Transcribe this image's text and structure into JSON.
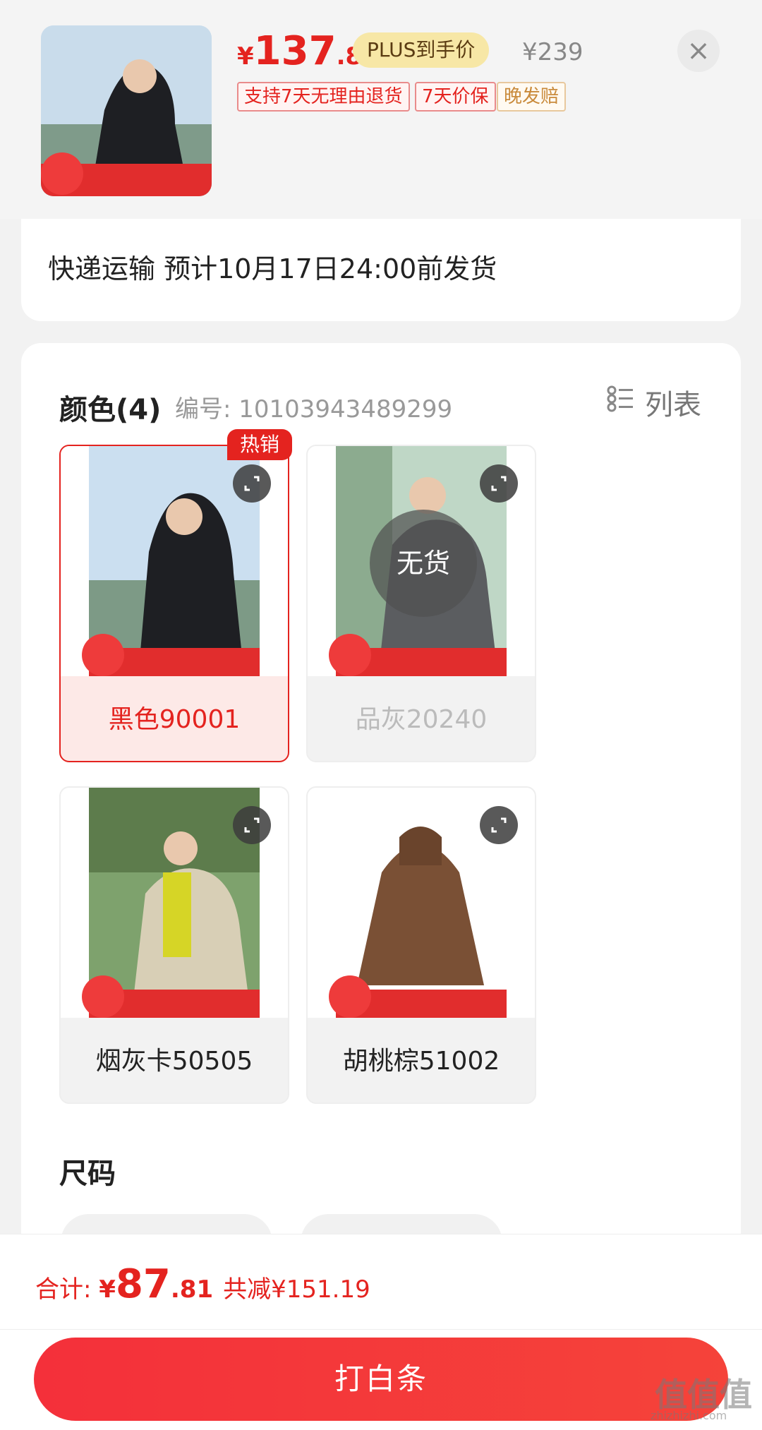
{
  "header": {
    "price_currency": "¥",
    "price_integer": "137",
    "price_decimal": ".81",
    "plus_badge": "PLUS到手价",
    "original_price": "¥239",
    "tags": [
      "支持7天无理由退货",
      "7天价保",
      "晚发赔"
    ]
  },
  "shipping": {
    "text": "快递运输 预计10月17日24:00前发货"
  },
  "color_section": {
    "title": "颜色(4)",
    "sku": "编号: 10103943489299",
    "list_label": "列表",
    "hot_badge": "热销",
    "no_stock_label": "无货",
    "variants": [
      {
        "name": "黑色90001"
      },
      {
        "name": "品灰20240"
      },
      {
        "name": "烟灰卡50505"
      },
      {
        "name": "胡桃棕51002"
      }
    ]
  },
  "size_section": {
    "title": "尺码"
  },
  "footer": {
    "total_label": "合计: ",
    "total_currency": "¥",
    "total_integer": "87",
    "total_decimal": ".81",
    "total_saving": "共减¥151.19",
    "pay_button": "打白条"
  },
  "watermark": {
    "main": "值值值",
    "sub": "zhizhizhi.com"
  },
  "colors": {
    "accent": "#e4231f",
    "plus_gold": "#f7e7a6"
  }
}
